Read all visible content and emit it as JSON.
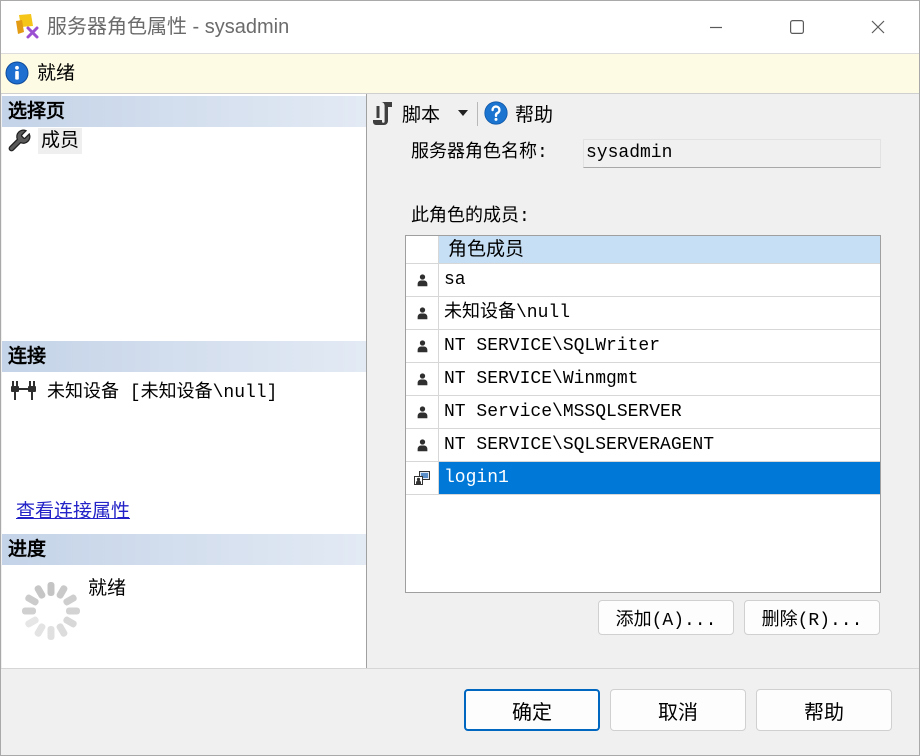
{
  "window": {
    "title": "服务器角色属性 - sysadmin"
  },
  "status_bar": {
    "icon": "info-icon",
    "text": "就绪"
  },
  "left_panel": {
    "select_page": {
      "header": "选择页",
      "items": [
        {
          "label": "成员",
          "icon": "wrench-icon"
        }
      ]
    },
    "connection": {
      "header": "连接",
      "icon": "plug-icon",
      "server": "未知设备 [未知设备\\null]",
      "view_properties_link": "查看连接属性"
    },
    "progress": {
      "header": "进度",
      "icon": "spinner-icon",
      "status": "就绪"
    }
  },
  "toolbar": {
    "script_label": "脚本",
    "script_icon": "script-icon",
    "help_label": "帮助",
    "help_icon": "help-icon"
  },
  "form": {
    "role_name_label": "服务器角色名称:",
    "role_name_value": "sysadmin",
    "members_label": "此角色的成员:",
    "members_column_header": "角色成员",
    "members": [
      {
        "name": "sa",
        "icon": "user-icon",
        "selected": false
      },
      {
        "name": "未知设备\\null",
        "icon": "user-icon",
        "selected": false
      },
      {
        "name": "NT SERVICE\\SQLWriter",
        "icon": "user-icon",
        "selected": false
      },
      {
        "name": "NT SERVICE\\Winmgmt",
        "icon": "user-icon",
        "selected": false
      },
      {
        "name": "NT Service\\MSSQLSERVER",
        "icon": "user-icon",
        "selected": false
      },
      {
        "name": "NT SERVICE\\SQLSERVERAGENT",
        "icon": "user-icon",
        "selected": false
      },
      {
        "name": "login1",
        "icon": "windows-login-icon",
        "selected": true
      }
    ],
    "add_button": "添加(A)...",
    "remove_button": "删除(R)..."
  },
  "footer": {
    "ok_button": "确定",
    "cancel_button": "取消",
    "help_button": "帮助"
  },
  "colors": {
    "selection": "#0078d7",
    "column_header": "#c7dff4",
    "status_bar": "#fdfbe3",
    "section_header": "#c4d3e8",
    "link": "#2323c8",
    "default_button_border": "#0067c0"
  }
}
